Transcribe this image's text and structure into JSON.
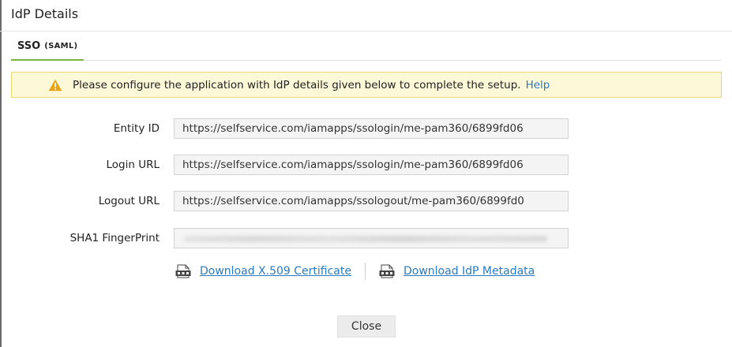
{
  "dialog": {
    "title": "IdP Details"
  },
  "tabs": [
    {
      "label": "SSO",
      "sublabel": "(SAML)",
      "active": true
    }
  ],
  "alert": {
    "message": "Please configure the application with IdP details given below to complete the setup.",
    "help_label": "Help",
    "icon": "warning-icon"
  },
  "fields": {
    "entity_id": {
      "label": "Entity ID",
      "value": "https://selfservice.com/iamapps/ssologin/me-pam360/6899fd06"
    },
    "login_url": {
      "label": "Login URL",
      "value": "https://selfservice.com/iamapps/ssologin/me-pam360/6899fd06"
    },
    "logout_url": {
      "label": "Logout URL",
      "value": "https://selfservice.com/iamapps/ssologout/me-pam360/6899fd0"
    },
    "sha1_fingerprint": {
      "label": "SHA1 FingerPrint",
      "value_obscured": true
    }
  },
  "downloads": {
    "certificate": {
      "label": "Download X.509 Certificate",
      "icon": "pem-file-icon"
    },
    "metadata": {
      "label": "Download IdP Metadata",
      "icon": "xml-file-icon"
    }
  },
  "actions": {
    "close_label": "Close"
  },
  "colors": {
    "accent_tab": "#7cb342",
    "link": "#2a7bbf",
    "alert_bg": "#fdf8d7",
    "alert_border": "#e8d774",
    "warning": "#e8a317"
  }
}
